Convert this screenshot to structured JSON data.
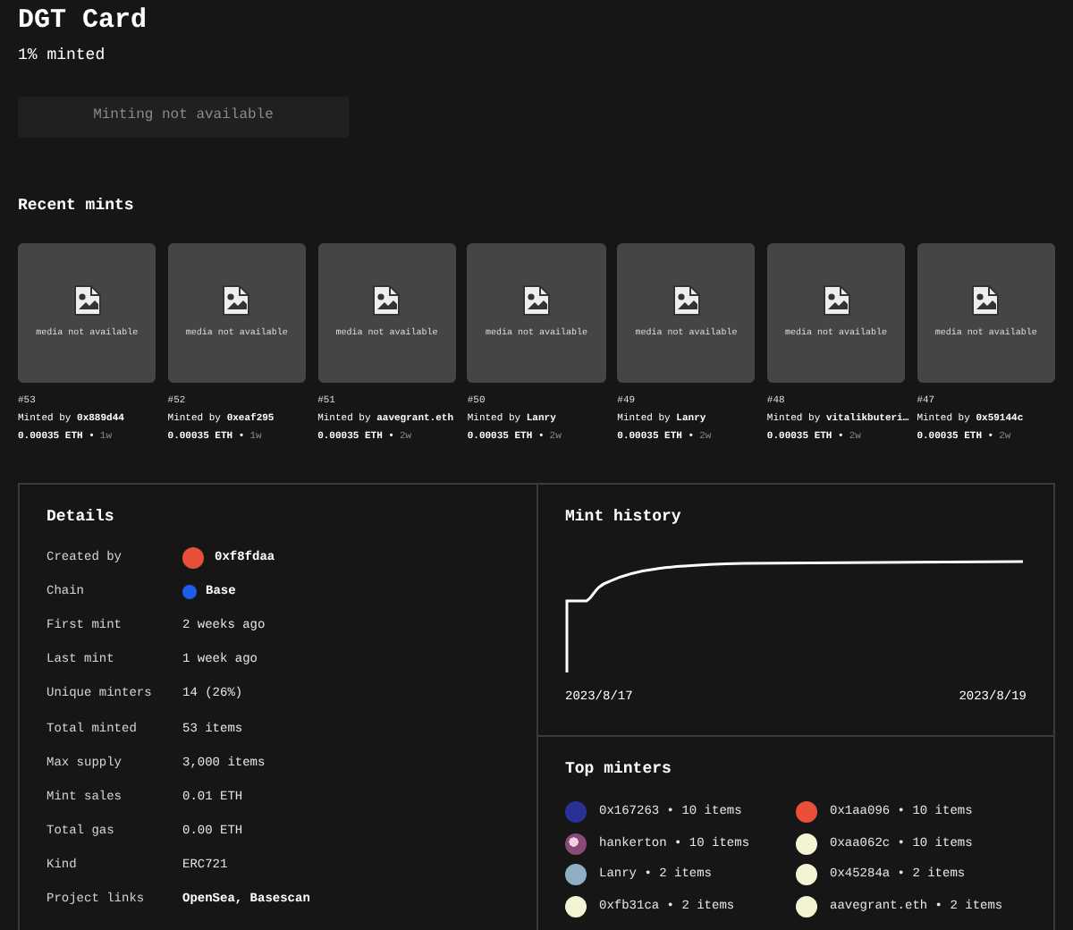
{
  "title": "DGT Card",
  "subtitle": "1% minted",
  "mint_button": {
    "label": "Minting not available",
    "disabled": true
  },
  "recent_mints": {
    "heading": "Recent mints",
    "items": [
      {
        "media": "media not available",
        "number": "#53",
        "minted_by": "Minted by",
        "minter": "0x889d44",
        "price": "0.00035 ETH •",
        "age": "1w"
      },
      {
        "media": "media not available",
        "number": "#52",
        "minted_by": "Minted by",
        "minter": "0xeaf295",
        "price": "0.00035 ETH •",
        "age": "1w"
      },
      {
        "media": "media not available",
        "number": "#51",
        "minted_by": "Minted by",
        "minter": "aavegrant.eth",
        "price": "0.00035 ETH •",
        "age": "2w"
      },
      {
        "media": "media not available",
        "number": "#50",
        "minted_by": "Minted by",
        "minter": "Lanry",
        "price": "0.00035 ETH •",
        "age": "2w"
      },
      {
        "media": "media not available",
        "number": "#49",
        "minted_by": "Minted by",
        "minter": "Lanry",
        "price": "0.00035 ETH •",
        "age": "2w"
      },
      {
        "media": "media not available",
        "number": "#48",
        "minted_by": "Minted by",
        "minter": "vitalikbuteri…",
        "price": "0.00035 ETH •",
        "age": "2w"
      },
      {
        "media": "media not available",
        "number": "#47",
        "minted_by": "Minted by",
        "minter": "0x59144c",
        "price": "0.00035 ETH •",
        "age": "2w"
      }
    ]
  },
  "details": {
    "heading": "Details",
    "rows": [
      {
        "label": "Created by",
        "kind": "address",
        "value": "0xf8fdaa",
        "color": "#e8503a"
      },
      {
        "label": "Chain",
        "kind": "chain",
        "value": "Base",
        "color": "#1f5ee8"
      },
      {
        "label": "First mint",
        "kind": "text",
        "value": "2 weeks ago"
      },
      {
        "label": "Last mint",
        "kind": "text",
        "value": "1 week ago"
      },
      {
        "label": "Unique minters",
        "kind": "text",
        "value": "14 (26%)"
      },
      {
        "label": "Total minted",
        "kind": "text",
        "value": "53 items"
      },
      {
        "label": "Max supply",
        "kind": "text",
        "value": "3,000 items"
      },
      {
        "label": "Mint sales",
        "kind": "text",
        "value": "0.01 ETH"
      },
      {
        "label": "Total gas",
        "kind": "text",
        "value": "0.00 ETH"
      },
      {
        "label": "Kind",
        "kind": "text",
        "value": "ERC721"
      },
      {
        "label": "Project links",
        "kind": "links",
        "value": "OpenSea, Basescan"
      }
    ]
  },
  "mint_history": {
    "heading": "Mint history",
    "start_label": "2023/8/17",
    "end_label": "2023/8/19"
  },
  "top_minters": {
    "heading": "Top minters",
    "items": [
      {
        "name": "0x167263 • 10 items",
        "color": "#2a3196"
      },
      {
        "name": "0x1aa096 • 10 items",
        "color": "#e8503a"
      },
      {
        "name": "hankerton • 10 items",
        "color": "#8a4a78",
        "kind": "avatar"
      },
      {
        "name": "0xaa062c • 10 items",
        "color": "#f3f5d2"
      },
      {
        "name": "Lanry • 2 items",
        "color": "#8fb0c4"
      },
      {
        "name": "0x45284a • 2 items",
        "color": "#f3f5d2"
      },
      {
        "name": "0xfb31ca • 2 items",
        "color": "#f3f5d2"
      },
      {
        "name": "aavegrant.eth • 2 items",
        "color": "#f3f5d2"
      }
    ]
  }
}
